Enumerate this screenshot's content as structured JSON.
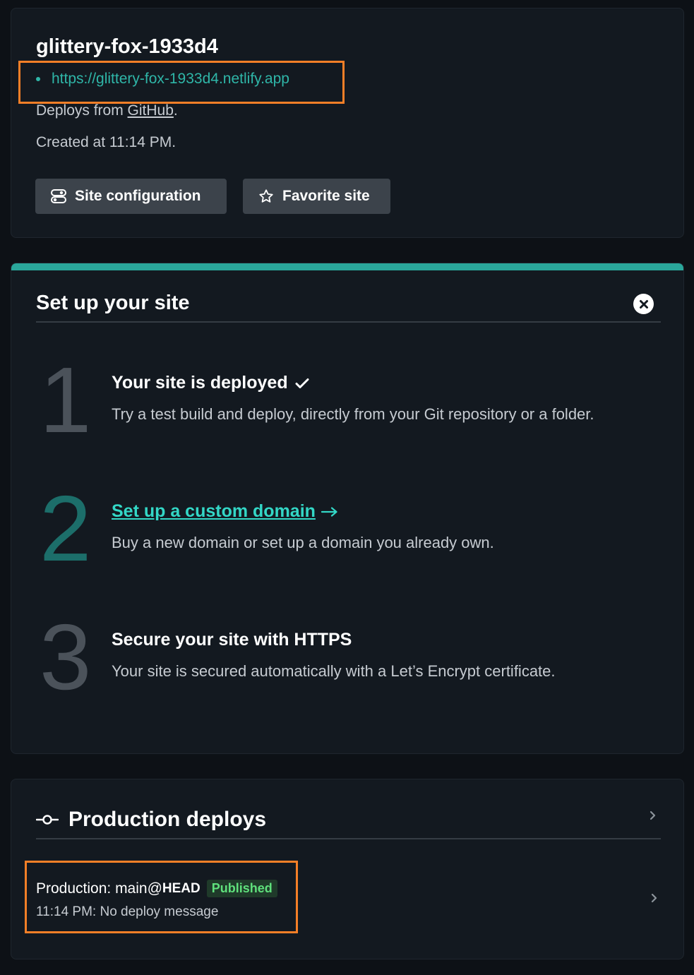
{
  "site": {
    "name": "glittery-fox-1933d4",
    "url": "https://glittery-fox-1933d4.netlify.app",
    "deploys_from_prefix": "Deploys from ",
    "deploys_from_link": "GitHub",
    "deploys_from_suffix": ".",
    "created_at": "Created at 11:14 PM.",
    "config_button": "Site configuration",
    "favorite_button": "Favorite site"
  },
  "setup": {
    "title": "Set up your site",
    "steps": [
      {
        "number": "1",
        "title": "Your site is deployed",
        "description": "Try a test build and deploy, directly from your Git repository or a folder."
      },
      {
        "number": "2",
        "title": "Set up a custom domain",
        "description": "Buy a new domain or set up a domain you already own."
      },
      {
        "number": "3",
        "title": "Secure your site with HTTPS",
        "description": "Your site is secured automatically with a Let’s Encrypt certificate."
      }
    ]
  },
  "production": {
    "title": "Production deploys",
    "deploy_label": "Production: main@",
    "deploy_ref": "HEAD",
    "status": "Published",
    "subtitle": "11:14 PM: No deploy message"
  },
  "colors": {
    "background": "#0d1116",
    "card": "#131920",
    "accent": "#2aa79b",
    "link": "#33d7c6",
    "highlight": "#f57f27",
    "published_badge": "#5fe07c"
  },
  "icons": {
    "config": "toggles-icon",
    "favorite": "star-icon",
    "close": "close-circle-icon",
    "check": "checkmark-icon",
    "arrow": "arrow-right-icon",
    "deploy": "git-commit-icon",
    "chevron": "chevron-right-icon"
  }
}
